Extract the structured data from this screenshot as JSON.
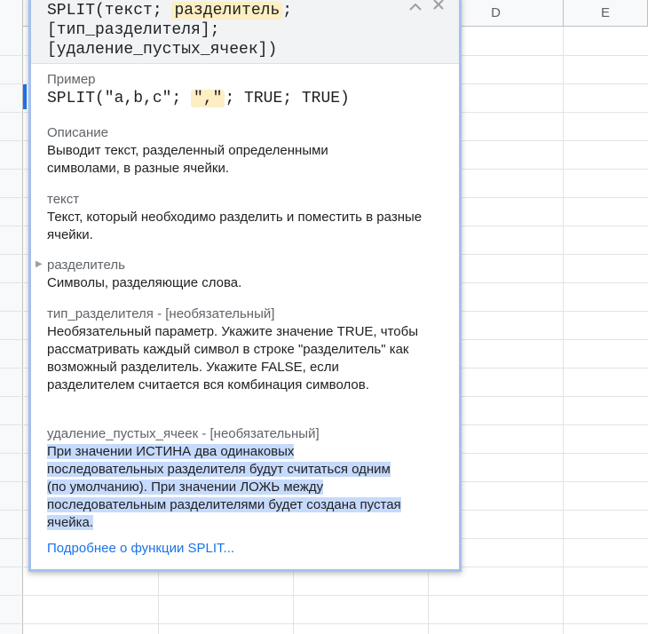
{
  "sheet": {
    "columns": [
      "D",
      "E"
    ]
  },
  "popup": {
    "signature": {
      "func_open": "SPLIT(текст; ",
      "arg_highlight": "разделитель",
      "line1_end": ";",
      "line2": "[тип_разделителя];",
      "line3": "[удаление_пустых_ячеек])"
    },
    "example": {
      "label": "Пример",
      "code_start": "SPLIT(\"a,b,c\"; ",
      "code_highlight": "\",\"",
      "code_end": "; TRUE; TRUE)"
    },
    "description": {
      "label": "Описание",
      "text": "Выводит текст, разделенный определенными символами, в разные ячейки."
    },
    "arg_text": {
      "label": "текст",
      "text": "Текст, который необходимо разделить и поместить в разные ячейки."
    },
    "arg_delimiter": {
      "label": "разделитель",
      "text": "Символы, разделяющие слова."
    },
    "arg_split_by_each": {
      "label": "тип_разделителя - [необязательный]",
      "text": "Необязательный параметр. Укажите значение TRUE, чтобы рассматривать каждый символ в строке \"разделитель\" как возможный разделитель. Укажите FALSE, если разделителем считается вся комбинация символов."
    },
    "arg_remove_empty": {
      "label": "удаление_пустых_ячеек - [необязательный]",
      "line1": "При значении ИСТИНА два одинаковых",
      "line2": "последовательных разделителя будут считаться одним",
      "line3": "(по умолчанию). При значении ЛОЖЬ между",
      "line4": "последовательным разделителями будет создана пустая",
      "line5": "ячейка."
    },
    "more_link": "Подробнее о функции SPLIT...",
    "icons": [
      "chevron-up-icon",
      "close-icon"
    ]
  }
}
